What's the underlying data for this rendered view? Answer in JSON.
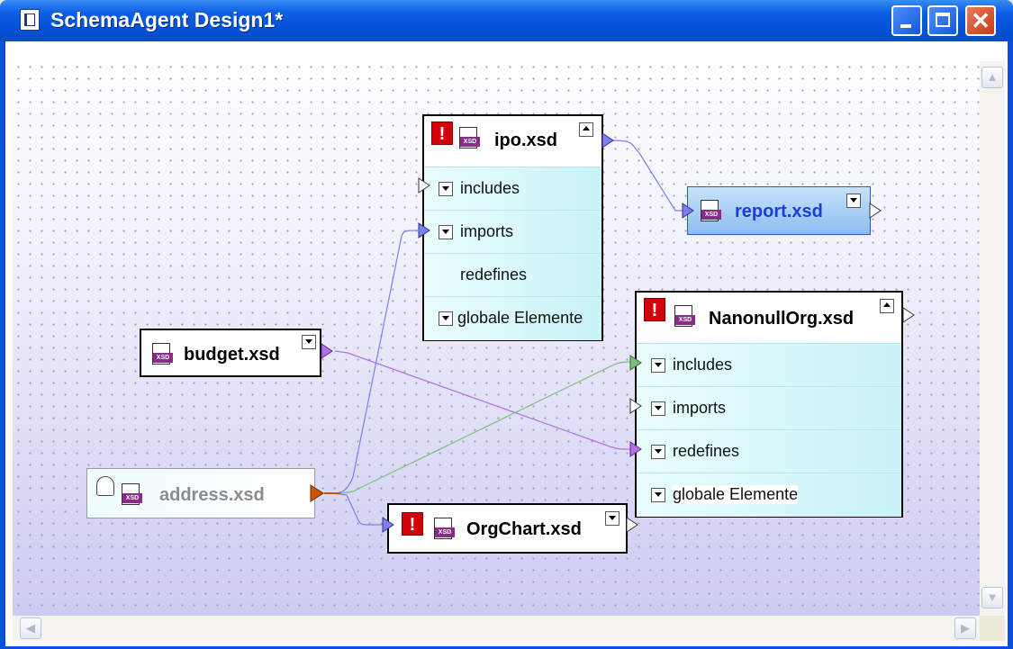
{
  "window": {
    "title": "SchemaAgent Design1*",
    "controls": {
      "minimize": "minimize",
      "maximize": "maximize",
      "close": "close"
    }
  },
  "colors": {
    "titlebar": "#0451d6",
    "canvas_bottom": "#cccbf1",
    "row_fill": "#d6f8fb",
    "report_fill": "#a9cef4",
    "link_purple_blue": "#7e7ef0",
    "link_violet": "#b271e6",
    "link_green": "#7cbf7c",
    "port_orange": "#cc5500",
    "error_red": "#d4000a"
  },
  "schemas": {
    "ipo": {
      "name": "ipo.xsd",
      "status": "error",
      "rows": [
        "includes",
        "imports",
        "redefines",
        "globale Elemente"
      ]
    },
    "report": {
      "name": "report.xsd"
    },
    "nanonull": {
      "name": "NanonullOrg.xsd",
      "status": "error",
      "rows": [
        "includes",
        "imports",
        "redefines",
        "globale Elemente"
      ]
    },
    "budget": {
      "name": "budget.xsd"
    },
    "address": {
      "name": "address.xsd"
    },
    "orgchart": {
      "name": "OrgChart.xsd",
      "status": "error"
    }
  },
  "icons": {
    "xsd_tag": "XSD",
    "error": "!"
  }
}
